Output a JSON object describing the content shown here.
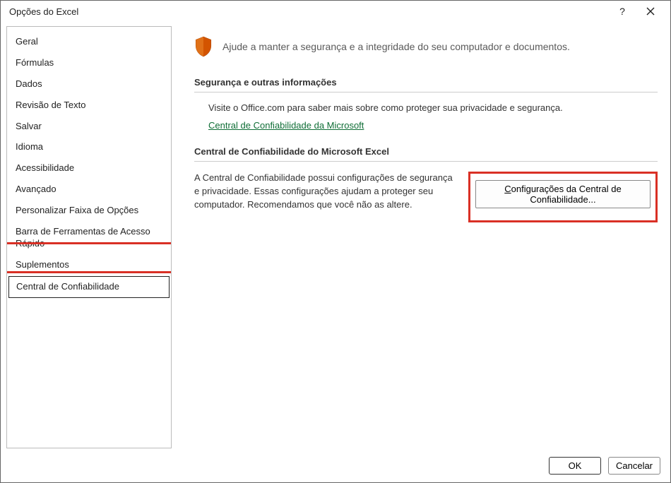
{
  "window": {
    "title": "Opções do Excel"
  },
  "sidebar": {
    "items": [
      "Geral",
      "Fórmulas",
      "Dados",
      "Revisão de Texto",
      "Salvar",
      "Idioma",
      "Acessibilidade",
      "Avançado",
      "Personalizar Faixa de Opções",
      "Barra de Ferramentas de Acesso Rápido",
      "Suplementos",
      "Central de Confiabilidade"
    ],
    "selected_index": 11
  },
  "content": {
    "intro": "Ajude a manter a segurança e a integridade do seu computador e documentos.",
    "section1": {
      "heading": "Segurança e outras informações",
      "text": "Visite o Office.com para saber mais sobre como proteger sua privacidade e segurança.",
      "link": "Central de Confiabilidade da Microsoft"
    },
    "section2": {
      "heading": "Central de Confiabilidade do Microsoft Excel",
      "desc": "A Central de Confiabilidade possui configurações de segurança e privacidade. Essas configurações ajudam a proteger seu computador. Recomendamos que você não as altere.",
      "button": "Configurações da Central de Confiabilidade..."
    }
  },
  "footer": {
    "ok": "OK",
    "cancel": "Cancelar"
  }
}
